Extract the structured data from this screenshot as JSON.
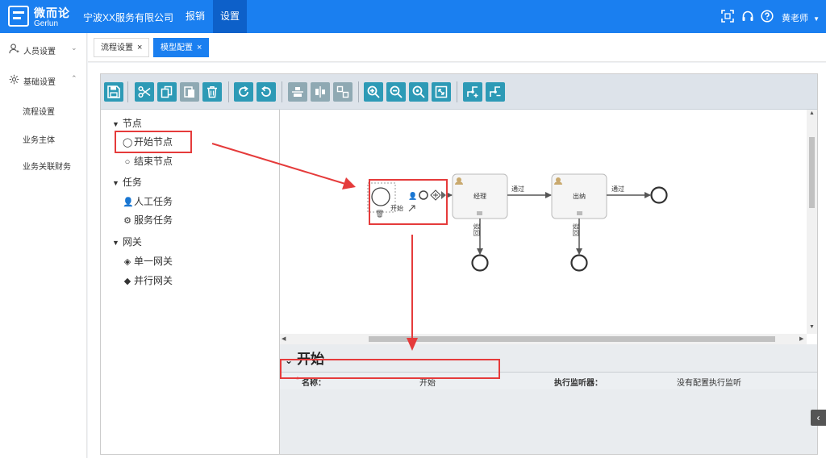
{
  "app": {
    "logo_cn": "微而论",
    "logo_en": "Gerlun",
    "company": "宁波XX服务有限公司",
    "nav": [
      "报销",
      "设置"
    ],
    "user": "黄老师",
    "header_icons": [
      "fullscreen-icon",
      "headset-icon",
      "help-icon"
    ],
    "accent_color": "#1a7ff0"
  },
  "sidebar": {
    "groups": [
      {
        "label": "人员设置",
        "icon": "user-icon",
        "expanded": false
      },
      {
        "label": "基础设置",
        "icon": "gear-icon",
        "expanded": true
      }
    ],
    "items": [
      "流程设置",
      "业务主体",
      "业务关联财务"
    ]
  },
  "tabs": [
    {
      "label": "流程设置",
      "active": false
    },
    {
      "label": "模型配置",
      "active": true
    }
  ],
  "toolbar": {
    "buttons": [
      "save-icon",
      "cut-icon",
      "copy-icon",
      "paste-icon",
      "delete-icon",
      "redo-icon",
      "undo-icon",
      "align-horizontal-icon",
      "align-vertical-icon",
      "same-size-icon",
      "zoom-in-icon",
      "zoom-out-icon",
      "zoom-actual-icon",
      "zoom-fit-icon",
      "bend-add-icon",
      "bend-remove-icon"
    ]
  },
  "palette": {
    "groups": [
      {
        "label": "节点",
        "items": [
          {
            "label": "开始节点",
            "icon": "start-event-icon"
          },
          {
            "label": "结束节点",
            "icon": "end-event-icon"
          }
        ]
      },
      {
        "label": "任务",
        "items": [
          {
            "label": "人工任务",
            "icon": "user-task-icon"
          },
          {
            "label": "服务任务",
            "icon": "service-task-icon"
          }
        ]
      },
      {
        "label": "网关",
        "items": [
          {
            "label": "单一网关",
            "icon": "exclusive-gateway-icon"
          },
          {
            "label": "并行网关",
            "icon": "parallel-gateway-icon"
          }
        ]
      }
    ]
  },
  "diagram": {
    "start_label": "开始",
    "task1": "经理",
    "task2": "出纳",
    "flow_pass": "通过",
    "flow_reject": "驳回"
  },
  "properties": {
    "title": "开始",
    "name_required_mark": "*",
    "name_label": "名称：",
    "name_value": "开始",
    "listener_label": "执行监听器：",
    "listener_value": "没有配置执行监听"
  },
  "annotation_color": "#e53b3b"
}
